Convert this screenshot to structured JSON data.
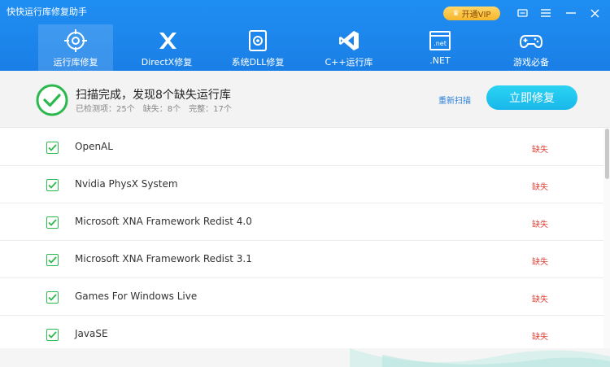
{
  "window": {
    "title": "快快运行库修复助手"
  },
  "topbar": {
    "vip_label": "开通VIP"
  },
  "nav": {
    "items": [
      {
        "label": "运行库修复",
        "icon": "target-icon",
        "active": true
      },
      {
        "label": "DirectX修复",
        "icon": "directx-icon",
        "active": false
      },
      {
        "label": "系统DLL修复",
        "icon": "dll-gear-icon",
        "active": false
      },
      {
        "label": "C++运行库",
        "icon": "visual-studio-icon",
        "active": false
      },
      {
        "label": ".NET",
        "icon": "dotnet-icon",
        "active": false
      },
      {
        "label": "游戏必备",
        "icon": "gamepad-icon",
        "active": false
      }
    ]
  },
  "summary": {
    "title": "扫描完成，发现8个缺失运行库",
    "detected": "已检测项：25个",
    "missing": "缺失：8个",
    "complete": "完整：17个",
    "rescan_label": "重新扫描",
    "fix_label": "立即修复"
  },
  "items": [
    {
      "name": "OpenAL",
      "status": "缺失"
    },
    {
      "name": "Nvidia PhysX System",
      "status": "缺失"
    },
    {
      "name": "Microsoft XNA Framework Redist 4.0",
      "status": "缺失"
    },
    {
      "name": "Microsoft XNA Framework Redist 3.1",
      "status": "缺失"
    },
    {
      "name": "Games For Windows Live",
      "status": "缺失"
    },
    {
      "name": "JavaSE",
      "status": "缺失"
    }
  ],
  "colors": {
    "accent": "#1a87ee",
    "missing": "#e0463c",
    "check": "#2db84d",
    "fix_button": "#1fc0ee"
  }
}
